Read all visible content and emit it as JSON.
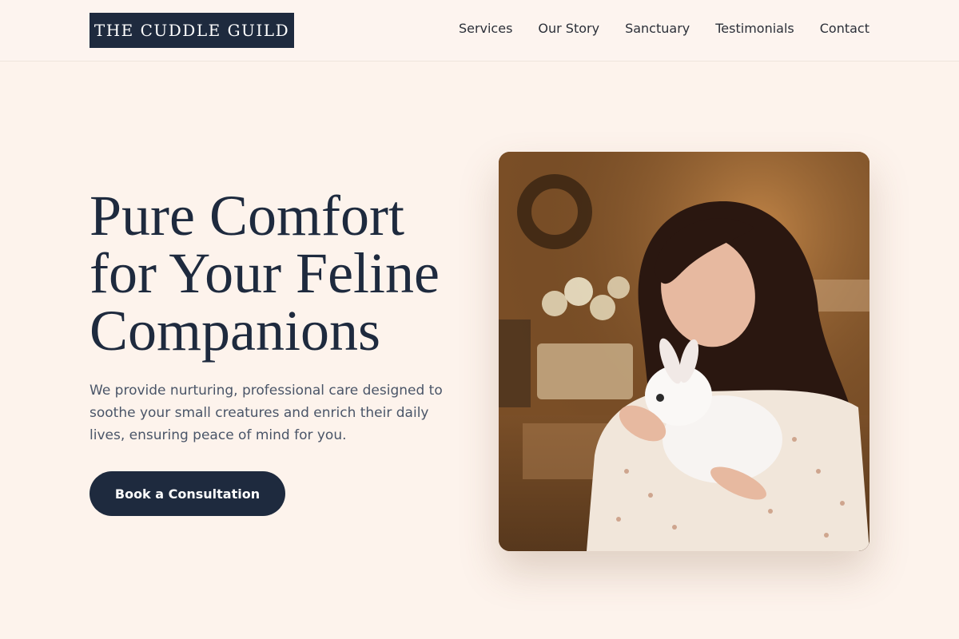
{
  "brand": {
    "name": "THE CUDDLE GUILD"
  },
  "nav": {
    "items": [
      {
        "label": "Services"
      },
      {
        "label": "Our Story"
      },
      {
        "label": "Sanctuary"
      },
      {
        "label": "Testimonials"
      },
      {
        "label": "Contact"
      }
    ]
  },
  "hero": {
    "title_lines": [
      "Pure Comfort",
      "for Your Feline",
      "Companions"
    ],
    "description": "We provide nurturing, professional care designed to soothe your small creatures and enrich their daily lives, ensuring peace of mind for you.",
    "cta_label": "Book a Consultation",
    "image_alt": "Woman gently cuddling a fluffy white rabbit in a warm rustic room"
  },
  "colors": {
    "background": "#fdf3ec",
    "primary": "#1e2a3e",
    "text_muted": "#4a5568"
  }
}
